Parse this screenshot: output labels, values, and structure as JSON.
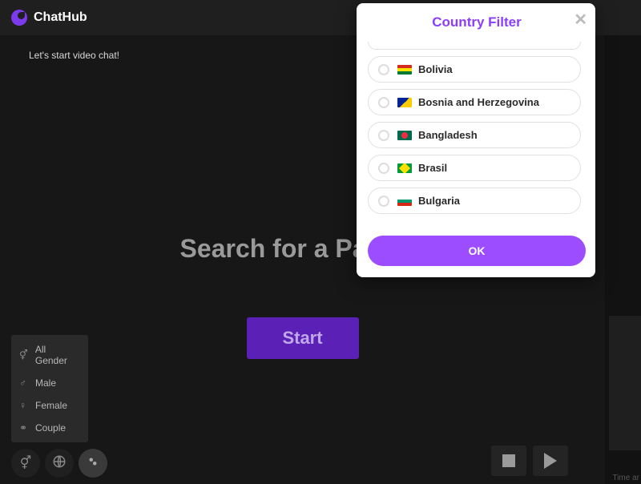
{
  "header": {
    "brand": "ChatHub"
  },
  "main": {
    "status": "Let's start video chat!",
    "search_title": "Search for a Partner",
    "start_label": "Start"
  },
  "gender_menu": {
    "items": [
      {
        "label": "All Gender",
        "icon": "⚥"
      },
      {
        "label": "Male",
        "icon": "♂"
      },
      {
        "label": "Female",
        "icon": "♀"
      },
      {
        "label": "Couple",
        "icon": "⚭"
      }
    ]
  },
  "modal": {
    "title": "Country Filter",
    "ok_label": "OK",
    "countries": [
      {
        "name": "Bolivia",
        "flag_class": "flag-bo"
      },
      {
        "name": "Bosnia and Herzegovina",
        "flag_class": "flag-ba"
      },
      {
        "name": "Bangladesh",
        "flag_class": "flag-bd"
      },
      {
        "name": "Brasil",
        "flag_class": "flag-br"
      },
      {
        "name": "Bulgaria",
        "flag_class": "flag-bg"
      }
    ]
  },
  "footer": {
    "time_hint": "Time ar"
  }
}
